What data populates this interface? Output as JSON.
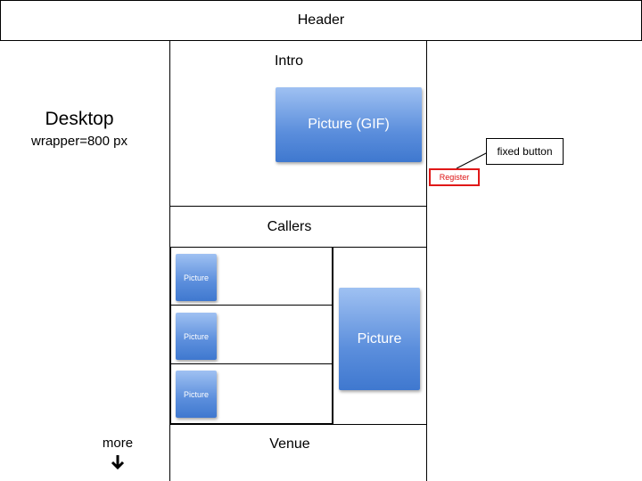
{
  "header": {
    "title": "Header"
  },
  "side": {
    "title": "Desktop",
    "subtitle": "wrapper=800 px",
    "more": "more",
    "more_icon": "arrow-down-icon"
  },
  "sections": {
    "intro": "Intro",
    "callers": "Callers",
    "venue": "Venue"
  },
  "pictures": {
    "gif": "Picture (GIF)",
    "small": [
      "Picture",
      "Picture",
      "Picture"
    ],
    "large": "Picture"
  },
  "register": {
    "label": "Register",
    "color": "#e01818"
  },
  "callout": {
    "label": "fixed button"
  },
  "colors": {
    "picture_fill": "#5b8edc",
    "stroke": "#000000"
  }
}
